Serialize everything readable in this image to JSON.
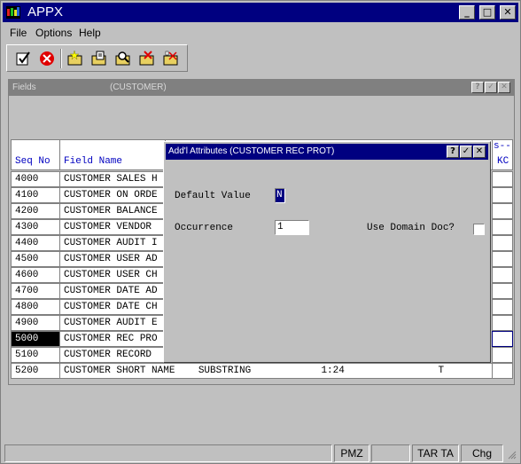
{
  "app": {
    "title": "APPX"
  },
  "titlebar_buttons": {
    "minimize": "_",
    "maximize": "□",
    "close": "✕"
  },
  "menu": [
    "File",
    "Options",
    "Help"
  ],
  "toolbar": [
    "check-doc-icon",
    "cancel-icon",
    "new-folder-icon",
    "edit-folder-icon",
    "find-folder-icon",
    "delete-folder-icon",
    "close-folder-icon"
  ],
  "fields_window": {
    "title": "Fields",
    "subtitle": "(CUSTOMER)",
    "buttons": {
      "help": "?",
      "ok": "✓",
      "close": "✕"
    },
    "headers": {
      "seq": "Seq No",
      "name": "Field Name",
      "right_top": "s--",
      "right_bottom": "KC"
    },
    "rows": [
      {
        "seq": "4000",
        "name": "CUSTOMER SALES H"
      },
      {
        "seq": "4100",
        "name": "CUSTOMER ON ORDE"
      },
      {
        "seq": "4200",
        "name": "CUSTOMER BALANCE"
      },
      {
        "seq": "4300",
        "name": "CUSTOMER VENDOR"
      },
      {
        "seq": "4400",
        "name": "CUSTOMER AUDIT I"
      },
      {
        "seq": "4500",
        "name": "CUSTOMER USER AD"
      },
      {
        "seq": "4600",
        "name": "CUSTOMER USER CH"
      },
      {
        "seq": "4700",
        "name": "CUSTOMER DATE AD"
      },
      {
        "seq": "4800",
        "name": "CUSTOMER DATE CH"
      },
      {
        "seq": "4900",
        "name": "CUSTOMER AUDIT E"
      },
      {
        "seq": "5000",
        "name": "CUSTOMER REC PRO"
      },
      {
        "seq": "5100",
        "name": "CUSTOMER RECORD"
      },
      {
        "seq": "5200",
        "name": "CUSTOMER SHORT NAME    SUBSTRING            1:24                T"
      }
    ],
    "selected_index": 10
  },
  "dialog": {
    "title": "Add'l Attributes (CUSTOMER REC PROT)",
    "buttons": {
      "help": "?",
      "ok": "✓",
      "close": "✕"
    },
    "default_value_label": "Default Value",
    "default_value": "N",
    "occurrence_label": "Occurrence",
    "occurrence_value": "1",
    "use_domain_doc_label": "Use Domain Doc?",
    "use_domain_doc_checked": false
  },
  "status": {
    "p1": "",
    "p2": "",
    "p3": "PMZ",
    "p4": "",
    "p5": "TAR TA",
    "p6": "Chg"
  }
}
